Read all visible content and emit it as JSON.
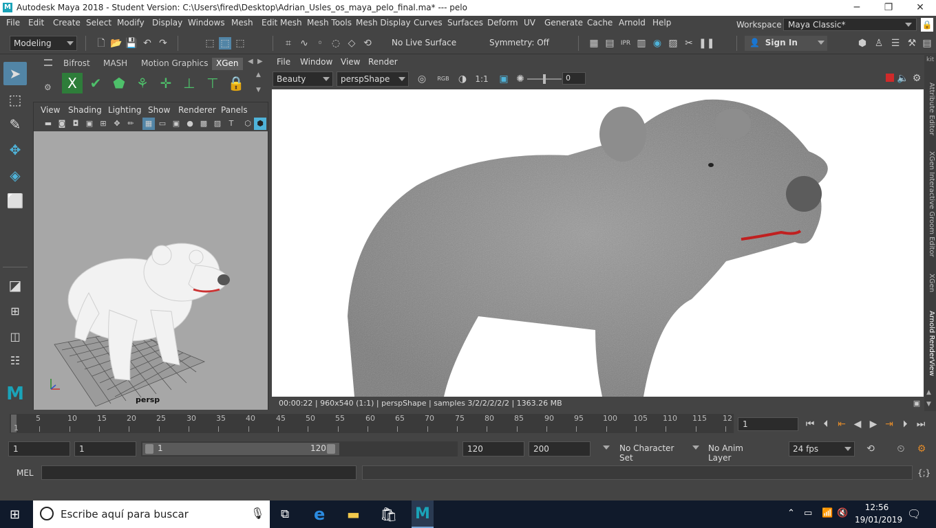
{
  "window": {
    "title": "Autodesk Maya 2018 - Student Version: C:\\Users\\fired\\Desktop\\Adrian_Usles_os_maya_pelo_final.ma*   ---   pelo",
    "logo": "M",
    "minimize": "─",
    "maximize": "❐",
    "close": "✕"
  },
  "menubar": {
    "items": [
      "File",
      "Edit",
      "Create",
      "Select",
      "Modify",
      "Display",
      "Windows",
      "Mesh",
      "Edit Mesh",
      "Mesh Tools",
      "Mesh Display",
      "Curves",
      "Surfaces",
      "Deform",
      "UV",
      "Generate",
      "Cache",
      "Arnold",
      "Help"
    ],
    "workspace_label": "Workspace :",
    "workspace_value": "Maya Classic*"
  },
  "statusline": {
    "menuset": "Modeling",
    "live_surface": "No Live Surface",
    "symmetry": "Symmetry: Off",
    "sign_in": "Sign In"
  },
  "shelf": {
    "tabs": [
      "Bifrost",
      "MASH",
      "Motion Graphics",
      "XGen"
    ],
    "active_tab": "XGen"
  },
  "viewport": {
    "menu": [
      "View",
      "Shading",
      "Lighting",
      "Show",
      "Renderer",
      "Panels"
    ],
    "camera_label": "persp"
  },
  "renderview": {
    "menu": [
      "File",
      "Window",
      "View",
      "Render"
    ],
    "aov": "Beauty",
    "camera": "perspShape",
    "ratio": "1:1",
    "exposure": "0",
    "status": "00:00:22 | 960x540 (1:1) | perspShape  | samples 3/2/2/2/2/2 | 1363.26 MB"
  },
  "right_tabs": [
    "Attribute Editor",
    "XGen Interactive Groom Editor",
    "XGen",
    "Arnold RenderView"
  ],
  "timeslider": {
    "ticks": [
      "5",
      "10",
      "15",
      "20",
      "25",
      "30",
      "35",
      "40",
      "45",
      "50",
      "55",
      "60",
      "65",
      "70",
      "75",
      "80",
      "85",
      "90",
      "95",
      "100",
      "105",
      "110",
      "115",
      "12"
    ],
    "current_marker": "1",
    "current_frame": "1"
  },
  "rangeslider": {
    "start": "1",
    "playback_start": "1",
    "range_start": "1",
    "range_end": "120",
    "playback_end": "120",
    "end": "200",
    "character_set": "No Character Set",
    "anim_layer": "No Anim Layer",
    "fps": "24 fps"
  },
  "cmdline": {
    "label": "MEL"
  },
  "taskbar": {
    "search_placeholder": "Escribe aquí para buscar",
    "time": "12:56",
    "date": "19/01/2019"
  }
}
